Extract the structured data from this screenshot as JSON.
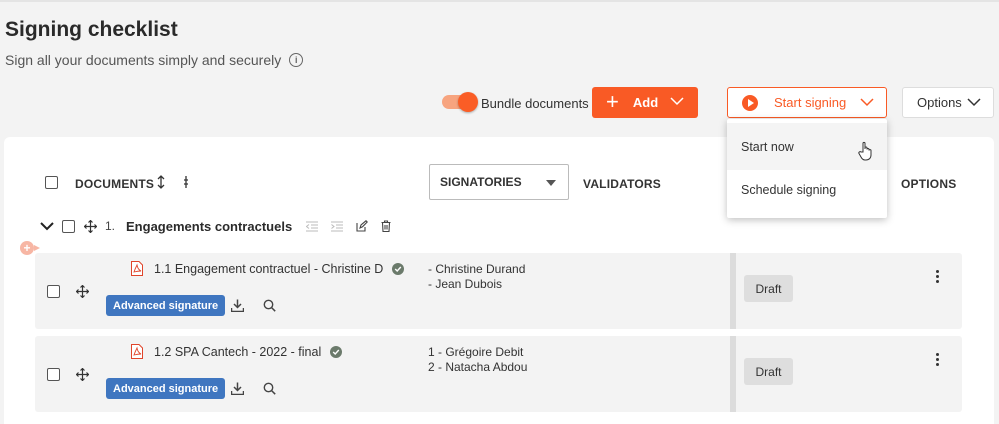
{
  "page": {
    "title": "Signing checklist",
    "subtitle": "Sign all your documents simply and securely"
  },
  "toolbar": {
    "bundle_label": "Bundle documents",
    "bundle_enabled": true,
    "add_label": "Add",
    "start_label": "Start signing",
    "options_label": "Options"
  },
  "start_menu": {
    "items": [
      "Start now",
      "Schedule signing"
    ]
  },
  "table": {
    "headers": {
      "documents": "DOCUMENTS",
      "signatories": "SIGNATORIES",
      "validators": "VALIDATORS",
      "options": "OPTIONS"
    },
    "group": {
      "number": "1.",
      "name": "Engagements contractuels"
    },
    "rows": [
      {
        "title": "1.1 Engagement contractuel - Christine D",
        "badge": "Advanced signature",
        "signatories": [
          "- Christine Durand",
          "- Jean Dubois"
        ],
        "status": "Draft"
      },
      {
        "title": "1.2 SPA Cantech - 2022 - final",
        "badge": "Advanced signature",
        "signatories": [
          "1 - Grégoire Debit",
          "2 - Natacha Abdou"
        ],
        "status": "Draft"
      }
    ]
  },
  "colors": {
    "accent": "#f95a25",
    "badge": "#3f76c0"
  }
}
